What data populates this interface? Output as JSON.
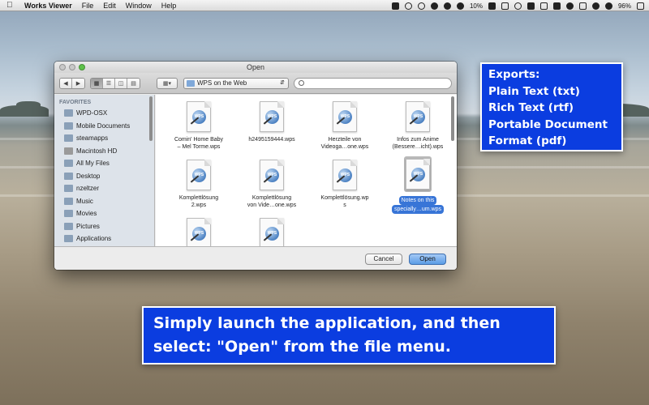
{
  "menubar": {
    "app_name": "Works Viewer",
    "menus": [
      "File",
      "Edit",
      "Window",
      "Help"
    ],
    "battery_left": "10%",
    "battery_right": "96%"
  },
  "dialog": {
    "title": "Open",
    "location": "WPS on the Web",
    "search_placeholder": "",
    "sidebar": {
      "header": "FAVORITES",
      "items": [
        "WPD-OSX",
        "Mobile Documents",
        "steamapps",
        "Macintosh HD",
        "All My Files",
        "Desktop",
        "nzeltzer",
        "Music",
        "Movies",
        "Pictures",
        "Applications"
      ]
    },
    "files": [
      {
        "name_line1": "Comin' Home Baby",
        "name_line2": "– Mel Torme.wps",
        "selected": false
      },
      {
        "name_line1": "h2495159444.wps",
        "name_line2": "",
        "selected": false
      },
      {
        "name_line1": "Herzteile von",
        "name_line2": "Videoga…one.wps",
        "selected": false
      },
      {
        "name_line1": "Infos zum Anime",
        "name_line2": "(Bessere…icht).wps",
        "selected": false
      },
      {
        "name_line1": "Komplettlösung",
        "name_line2": "2.wps",
        "selected": false
      },
      {
        "name_line1": "Komplettlösung",
        "name_line2": "von Vide…one.wps",
        "selected": false
      },
      {
        "name_line1": "Komplettlösung.wp",
        "name_line2": "s",
        "selected": false
      },
      {
        "name_line1": "Notes on this",
        "name_line2": "specially…um.wps",
        "selected": true
      },
      {
        "name_line1": "",
        "name_line2": "",
        "selected": false
      },
      {
        "name_line1": "",
        "name_line2": "",
        "selected": false
      }
    ],
    "cancel_label": "Cancel",
    "open_label": "Open"
  },
  "exports": {
    "lines": [
      "Exports:",
      "Plain Text (txt)",
      "Rich Text (rtf)",
      "Portable Document",
      "Format (pdf)"
    ]
  },
  "banner": {
    "line1": "Simply launch the application, and then",
    "line2": "select: \"Open\" from the file menu."
  },
  "colors": {
    "callout_blue": "#0b3de0",
    "selection_blue": "#3875d7",
    "zoom_green": "#5ec24a"
  }
}
